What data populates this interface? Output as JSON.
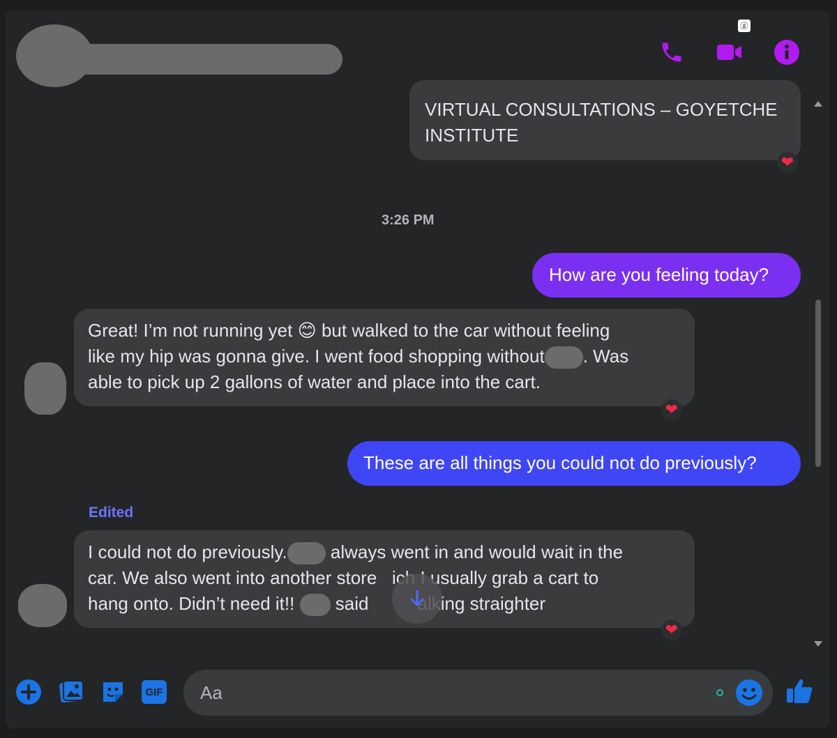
{
  "header": {
    "call_icon": "phone-icon",
    "video_icon": "video-camera-icon",
    "info_icon": "info-icon",
    "accent_color": "#a020f0"
  },
  "messages": [
    {
      "id": "m1",
      "direction": "outgoing",
      "text": "VIRTUAL CONSULTATIONS – GOYETCHE INSTITUTE",
      "reaction": "❤️"
    },
    {
      "id": "ts1",
      "type": "timestamp",
      "text": "3:26 PM"
    },
    {
      "id": "m2",
      "direction": "outgoing",
      "text": "How are you feeling today?",
      "color": "#7b2ff0"
    },
    {
      "id": "m3",
      "direction": "incoming",
      "line1": "Great! I’m not running yet",
      "line1_emoji": "😊",
      "line1_rest": "but walked to the car without feeling",
      "line2a": "like my hip was gonna give. I went food shopping without",
      "line2b": ". Was",
      "line3": "able to pick up 2 gallons of water and place into the cart.",
      "reaction": "❤️"
    },
    {
      "id": "m4",
      "direction": "outgoing",
      "text": "These are all things you could not do previously?",
      "color": "#3f46f5"
    },
    {
      "id": "edited_label",
      "text": "Edited"
    },
    {
      "id": "m5",
      "direction": "incoming",
      "line1a": "I could not do previously.",
      "line1b": "always went in and would wait in the",
      "line2a": "car. We also went into another store",
      "line2b": "ich I usually grab a cart to",
      "line3a": "hang onto. Didn’t need it!!",
      "line3b": "said",
      "line3c": "alking straighter",
      "reaction": "❤️"
    }
  ],
  "composer": {
    "placeholder": "Aa",
    "tools": [
      "plus-icon",
      "image-icon",
      "sticker-icon",
      "gif-icon"
    ],
    "gif_label": "GIF",
    "like_icon": "thumbs-up-icon",
    "accent_color": "#1b74e4"
  },
  "scroll_down_icon": "arrow-down-icon"
}
